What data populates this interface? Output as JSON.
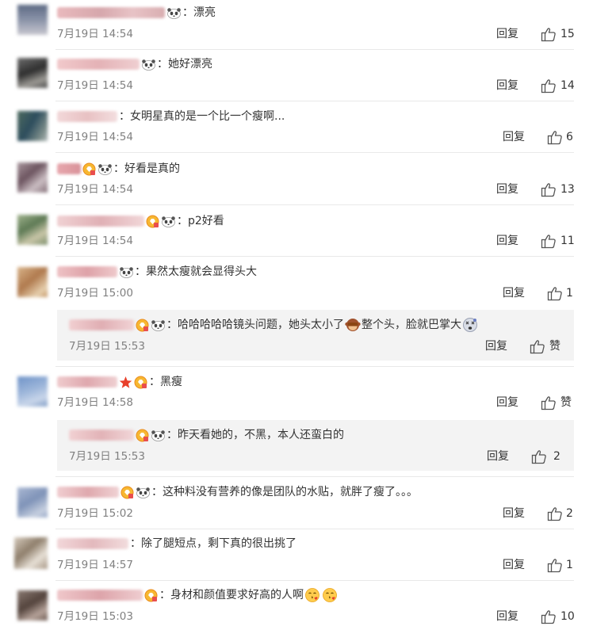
{
  "reply_label": "回复",
  "like_label": "赞",
  "comments": [
    {
      "text": "漂亮",
      "time": "7月19日 14:54",
      "likes": "15"
    },
    {
      "text": "她好漂亮",
      "time": "7月19日 14:54",
      "likes": "14"
    },
    {
      "text": "女明星真的是一个比一个瘦啊...",
      "time": "7月19日 14:54",
      "likes": "6"
    },
    {
      "text": "好看是真的",
      "time": "7月19日 14:54",
      "likes": "13"
    },
    {
      "text": "p2好看",
      "time": "7月19日 14:54",
      "likes": "11"
    },
    {
      "text": "果然太瘦就会显得头大",
      "time": "7月19日 15:00",
      "likes": "1",
      "sub": {
        "text_a": "哈哈哈哈哈镜头问题，她头太小了",
        "text_b": "整个头，脸就巴掌大",
        "time": "7月19日 15:53",
        "likes": "赞"
      }
    },
    {
      "text": "黑瘦",
      "time": "7月19日 14:58",
      "likes": "赞",
      "sub": {
        "text": "昨天看她的，不黑，本人还蛮白的",
        "time": "7月19日 15:53",
        "likes": "2"
      }
    },
    {
      "text": "这种料没有营养的像是团队的水贴，就胖了瘦了。。。",
      "time": "7月19日 15:02",
      "likes": "2"
    },
    {
      "text": "除了腿短点，剩下真的很出挑了",
      "time": "7月19日 14:57",
      "likes": "1"
    },
    {
      "text": "身材和颜值要求好高的人啊",
      "time": "7月19日 15:03",
      "likes": "10"
    }
  ],
  "icons": {
    "panda": "panda-emoji-icon",
    "badge": "vip-badge-icon",
    "star": "star-badge-icon",
    "like": "thumbs-up-icon",
    "monkey": "see-no-evil-monkey-icon",
    "dizzy": "dizzy-face-icon",
    "kiss": "kissing-face-icon"
  },
  "colors": {
    "text": "#333333",
    "time": "#808080",
    "sub_bg": "#f3f3f3",
    "divider": "#e9e9e9"
  }
}
